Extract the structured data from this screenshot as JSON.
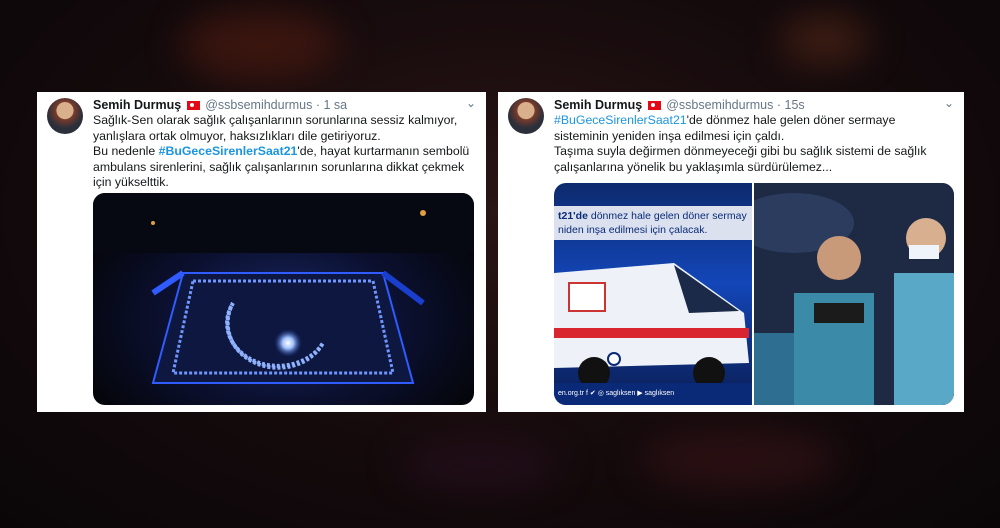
{
  "tweets": [
    {
      "name": "Semih Durmuş",
      "handle": "@ssbsemihdurmus",
      "separator": "·",
      "time": "1 sa",
      "chevron": "⌄",
      "line1": "Sağlık-Sen olarak sağlık çalışanlarının sorunlarına sessiz kalmıyor, yanlışlara ortak olmuyor, haksızlıkları dile getiriyoruz.",
      "line2_pre": "Bu nedenle ",
      "hashtag": "#BuGeceSirenlerSaat21",
      "line2_post": "'de, hayat kurtarmanın sembolü ambulans sirenlerini, sağlık çalışanlarının sorunlarına dikkat çekmek için yükselttik.",
      "media_description": "aerial-night-light-formation"
    },
    {
      "name": "Semih Durmuş",
      "handle": "@ssbsemihdurmus",
      "separator": "·",
      "time": "15s",
      "chevron": "⌄",
      "hashtag": "#BuGeceSirenlerSaat21",
      "line1_post": "'de dönmez hale gelen döner sermaye sisteminin yeniden inşa edilmesi için çaldı.",
      "line2": "Taşıma suyla değirmen dönmeyeceği gibi bu sağlık sistemi de sağlık çalışanlarına yönelik bu yaklaşımla sürdürülemez...",
      "media_caption_bold": "t21'de",
      "media_caption_rest": " dönmez hale gelen döner sermay niden inşa edilmesi için çalacak.",
      "media_footer": "en.org.tr  f ✔ ◎ saglıksen  ▶ saglıksen"
    }
  ],
  "colors": {
    "link": "#1b95e0",
    "text": "#14171a",
    "muted": "#657786",
    "flag": "#e30a17"
  },
  "icons": [
    "turkish-flag-icon",
    "chevron-down-icon"
  ]
}
